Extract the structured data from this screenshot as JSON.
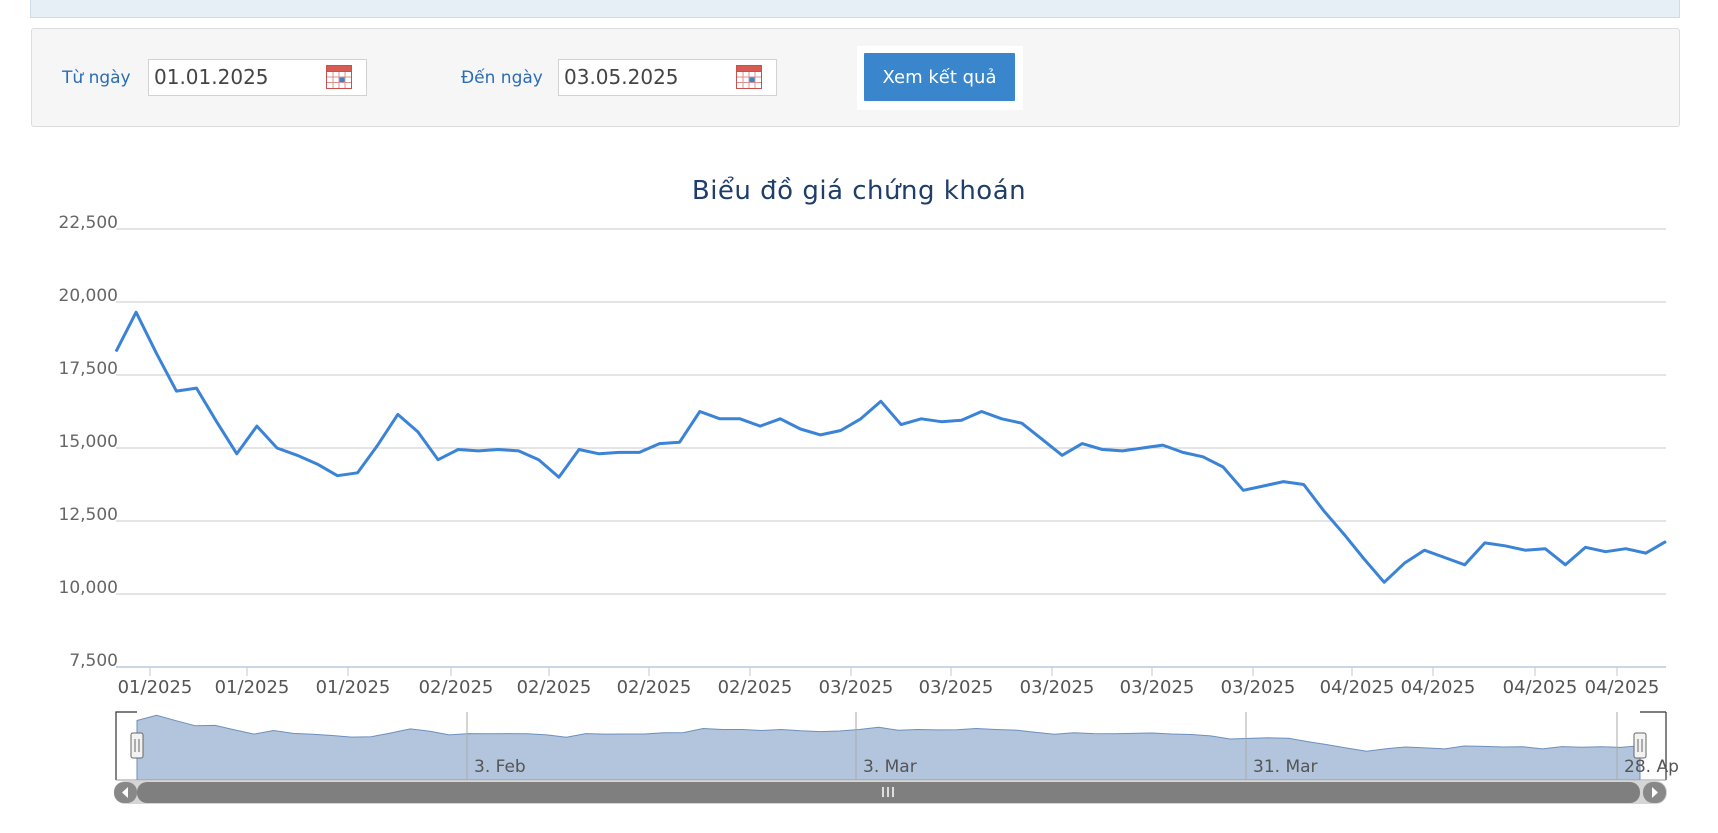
{
  "filter": {
    "from_label": "Từ ngày",
    "from_value": "01.01.2025",
    "to_label": "Đến ngày",
    "to_value": "03.05.2025",
    "submit_label": "Xem kết quả"
  },
  "colors": {
    "accent": "#3a86cc",
    "line": "#3a83d6",
    "navigator_fill": "#b3c5dd",
    "scrollbar": "#7f7f7f"
  },
  "chart_data": {
    "type": "line",
    "title": "Biểu đồ giá chứng khoán",
    "xlabel": "",
    "ylabel": "",
    "ylim": [
      7500,
      22500
    ],
    "yticks": [
      "7,500",
      "10,000",
      "12,500",
      "15,000",
      "17,500",
      "20,000",
      "22,500"
    ],
    "xtick_labels": [
      "01/2025",
      "01/2025",
      "01/2025",
      "02/2025",
      "02/2025",
      "02/2025",
      "02/2025",
      "03/2025",
      "03/2025",
      "03/2025",
      "03/2025",
      "03/2025",
      "04/2025",
      "04/2025",
      "04/2025",
      "04/2025"
    ],
    "navigator_labels": [
      "3. Feb",
      "3. Mar",
      "31. Mar",
      "28. Ap"
    ],
    "grid": true,
    "legend": "none",
    "series": [
      {
        "values": [
          18300,
          19650,
          18250,
          16950,
          17050,
          15900,
          14800,
          15750,
          15000,
          14750,
          14450,
          14050,
          14150,
          15100,
          16150,
          15550,
          14600,
          14950,
          14900,
          14950,
          14900,
          14600,
          14000,
          14950,
          14800,
          14850,
          14850,
          15150,
          15200,
          16250,
          16000,
          16000,
          15750,
          16000,
          15650,
          15450,
          15600,
          16000,
          16600,
          15800,
          16000,
          15900,
          15950,
          16250,
          16000,
          15850,
          15300,
          14750,
          15150,
          14950,
          14900,
          15000,
          15100,
          14850,
          14700,
          14350,
          13550,
          13700,
          13850,
          13750,
          12850,
          12050,
          11200,
          10400,
          11050,
          11500,
          11250,
          11000,
          11750,
          11650,
          11500,
          11550,
          11000,
          11600,
          11450,
          11550,
          11400,
          11800
        ]
      }
    ]
  }
}
